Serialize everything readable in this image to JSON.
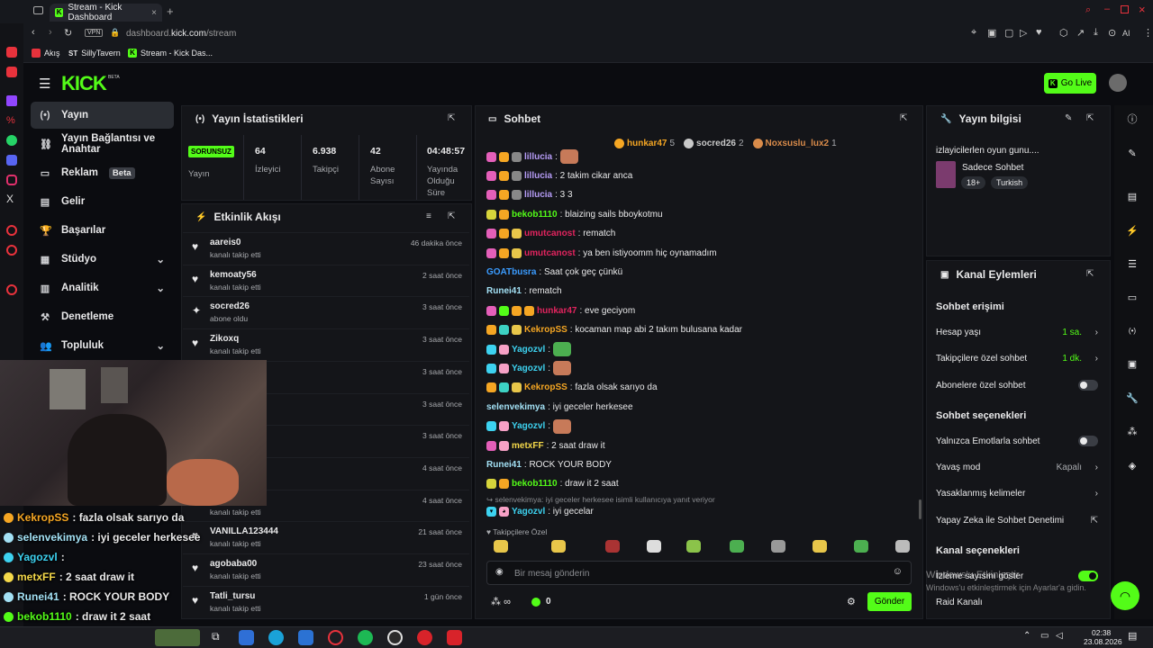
{
  "browser": {
    "tab_title": "Stream - Kick Dashboard",
    "url_host": "dashboard.",
    "url_bold": "kick.com",
    "url_path": "/stream",
    "bookmarks": [
      "Akış",
      "SillyTavern",
      "Stream - Kick Das..."
    ],
    "ai_label": "AI"
  },
  "header": {
    "logo": "KICK",
    "beta": "BETA",
    "go_live": "Go Live"
  },
  "nav": [
    {
      "label": "Yayın",
      "icon": "(•)"
    },
    {
      "label": "Yayın Bağlantısı ve Anahtar",
      "icon": "⛓"
    },
    {
      "label": "Reklam",
      "icon": "▭",
      "badge": "Beta"
    },
    {
      "label": "Gelir",
      "icon": "▤"
    },
    {
      "label": "Başarılar",
      "icon": "🏆"
    },
    {
      "label": "Stüdyo",
      "icon": "▦",
      "chev": "⌄"
    },
    {
      "label": "Analitik",
      "icon": "▥",
      "chev": "⌄"
    },
    {
      "label": "Denetleme",
      "icon": "⚒"
    },
    {
      "label": "Topluluk",
      "icon": "👥",
      "chev": "⌄"
    }
  ],
  "stats": {
    "title": "Yayın İstatistikleri",
    "status_badge": "SORUNSUZ",
    "status_label": "Yayın",
    "items": [
      {
        "value": "64",
        "label": "İzleyici"
      },
      {
        "value": "6.938",
        "label": "Takipçi"
      },
      {
        "value": "42",
        "label": "Abone Sayısı"
      },
      {
        "value": "04:48:57",
        "label": "Yayında Olduğu Süre"
      }
    ]
  },
  "activity": {
    "title": "Etkinlik Akışı",
    "events": [
      {
        "name": "aareis0",
        "sub": "kanalı takip etti",
        "time": "46 dakika önce",
        "icon": "♥"
      },
      {
        "name": "kemoaty56",
        "sub": "kanalı takip etti",
        "time": "2 saat önce",
        "icon": "♥"
      },
      {
        "name": "socred26",
        "sub": "abone oldu",
        "time": "3 saat önce",
        "icon": "✦"
      },
      {
        "name": "Zikoxq",
        "sub": "kanalı takip etti",
        "time": "3 saat önce",
        "icon": "♥"
      },
      {
        "name": "",
        "sub": "",
        "time": "3 saat önce",
        "icon": ""
      },
      {
        "name": "",
        "sub": "",
        "time": "3 saat önce",
        "icon": ""
      },
      {
        "name": "",
        "sub": "",
        "time": "3 saat önce",
        "icon": ""
      },
      {
        "name": "",
        "sub": "",
        "time": "4 saat önce",
        "icon": ""
      },
      {
        "name": "",
        "sub": "kanalı takip etti",
        "time": "4 saat önce",
        "icon": ""
      },
      {
        "name": "VANILLA123444",
        "sub": "kanalı takip etti",
        "time": "21 saat önce",
        "icon": "♥"
      },
      {
        "name": "agobaba00",
        "sub": "kanalı takip etti",
        "time": "23 saat önce",
        "icon": "♥"
      },
      {
        "name": "Tatli_tursu",
        "sub": "kanalı takip etti",
        "time": "1 gün önce",
        "icon": "♥"
      }
    ]
  },
  "chat": {
    "title": "Sohbet",
    "top_gifters": [
      {
        "name": "hunkar47",
        "count": "5",
        "color": "#f5a623"
      },
      {
        "name": "socred26",
        "count": "2",
        "color": "#c9c9c9"
      },
      {
        "name": "Noxsuslu_lux2",
        "count": "1",
        "color": "#d98b4a"
      }
    ],
    "messages": [
      {
        "user": "lillucia",
        "text": ":",
        "color": "#b69cf6",
        "badges": [
          "#e45fb9",
          "#f5a623",
          "#888"
        ],
        "emote": "#c77a59"
      },
      {
        "user": "lillucia",
        "text": ": 2 takim cikar anca",
        "color": "#b69cf6",
        "badges": [
          "#e45fb9",
          "#f5a623",
          "#888"
        ]
      },
      {
        "user": "lillucia",
        "text": ": 3 3",
        "color": "#b69cf6",
        "badges": [
          "#e45fb9",
          "#f5a623",
          "#888"
        ]
      },
      {
        "user": "bekob1110",
        "text": ": blaizing sails bboykotmu",
        "color": "#53fc18",
        "badges": [
          "#d6d43b",
          "#f5a623"
        ]
      },
      {
        "user": "umutcanost",
        "text": ": rematch",
        "color": "#e0245e",
        "badges": [
          "#e45fb9",
          "#f5a623",
          "#e8c64a"
        ]
      },
      {
        "user": "umutcanost",
        "text": ": ya ben istiyoomm hiç oynamadım",
        "color": "#e0245e",
        "badges": [
          "#e45fb9",
          "#f5a623",
          "#e8c64a"
        ]
      },
      {
        "user": "GOATbusra",
        "text": ": Saat çok geç çünkü",
        "color": "#3b9cff",
        "badges": []
      },
      {
        "user": "Runei41",
        "text": ": rematch",
        "color": "#a3e1f5",
        "badges": []
      },
      {
        "user": "hunkar47",
        "text": ": eve geciyom",
        "color": "#e0245e",
        "badges": [
          "#e45fb9",
          "#53fc18",
          "#f5a623",
          "#f5a623"
        ]
      },
      {
        "user": "KekropSS",
        "text": ": kocaman map abi 2 takım bulusana kadar",
        "color": "#f5a623",
        "badges": [
          "#f5a623",
          "#3dd2c4",
          "#e8c64a"
        ]
      },
      {
        "user": "Yagozvl",
        "text": ":",
        "color": "#3dd2f0",
        "badges": [
          "#3dd2f0",
          "#f7a1c6"
        ],
        "emote": "#4caf50"
      },
      {
        "user": "Yagozvl",
        "text": ":",
        "color": "#3dd2f0",
        "badges": [
          "#3dd2f0",
          "#f7a1c6"
        ],
        "emote": "#c77a59"
      },
      {
        "user": "KekropSS",
        "text": ": fazla olsak sarıyo da",
        "color": "#f5a623",
        "badges": [
          "#f5a623",
          "#3dd2c4",
          "#e8c64a"
        ]
      },
      {
        "user": "selenvekimya",
        "text": ": iyi geceler herkesee",
        "color": "#a3e1f5",
        "badges": []
      },
      {
        "user": "Yagozvl",
        "text": ":",
        "color": "#3dd2f0",
        "badges": [
          "#3dd2f0",
          "#f7a1c6"
        ],
        "emote": "#c77a59"
      },
      {
        "user": "metxFF",
        "text": ": 2 saat draw it",
        "color": "#f5d94a",
        "badges": [
          "#e45fb9",
          "#f7a1c6"
        ]
      },
      {
        "user": "Runei41",
        "text": ": ROCK YOUR BODY",
        "color": "#a3e1f5",
        "badges": []
      },
      {
        "user": "bekob1110",
        "text": ": draw it 2 saat",
        "color": "#53fc18",
        "badges": [
          "#d6d43b",
          "#f5a623"
        ]
      }
    ],
    "reply_hint": "selenvekimya: iyi geceler herkesee isimli kullanıcıya yanıt veriyor",
    "reply_user": "Yagozvl",
    "reply_text": ": iyi gecelar",
    "followers_only": "Takipçilere Özel",
    "input_placeholder": "Bir mesaj gönderin",
    "infinity": "∞",
    "points": "0",
    "send_label": "Gönder"
  },
  "stream_info": {
    "title": "Yayın bilgisi",
    "stream_title": "izlayicilerlen oyun gunu....",
    "category": "Sadece Sohbet",
    "tags": [
      "18+",
      "Turkish"
    ]
  },
  "channel_actions": {
    "title": "Kanal Eylemleri",
    "chat_access": "Sohbet erişimi",
    "account_age_label": "Hesap yaşı",
    "account_age_val": "1 sa.",
    "followers_chat_label": "Takipçilere özel sohbet",
    "followers_chat_val": "1 dk.",
    "subs_chat_label": "Abonelere özel sohbet",
    "chat_options": "Sohbet seçenekleri",
    "emote_only": "Yalnızca Emotlarla sohbet",
    "slow_mode": "Yavaş mod",
    "slow_mode_val": "Kapalı",
    "banned_words": "Yasaklanmış kelimeler",
    "ai_mod": "Yapay Zeka ile Sohbet Denetimi",
    "channel_options": "Kanal seçenekleri",
    "show_viewers": "İzleme sayısını göster",
    "raid": "Raid Kanalı"
  },
  "watermark": {
    "line1": "Windows'u Etkinleştir",
    "line2": "Windows'u etkinleştirmek için Ayarlar'a gidin."
  },
  "overlay": [
    {
      "user": "KekropSS",
      "text": ": fazla olsak sarıyo da",
      "color": "#f5a623"
    },
    {
      "user": "selenvekimya",
      "text": ": iyi geceler herkesee",
      "color": "#a3e1f5"
    },
    {
      "user": "Yagozvl",
      "text": ":",
      "color": "#3dd2f0"
    },
    {
      "user": "metxFF",
      "text": ": 2 saat draw it",
      "color": "#f5d94a"
    },
    {
      "user": "Runei41",
      "text": ": ROCK YOUR BODY",
      "color": "#a3e1f5"
    },
    {
      "user": "bekob1110",
      "text": ": draw it 2 saat",
      "color": "#53fc18"
    },
    {
      "user": "Yagozvl",
      "text": ": iyi gecelar",
      "color": "#3dd2f0"
    }
  ],
  "taskbar": {
    "time": "02:38",
    "date": "23.08.2026"
  }
}
